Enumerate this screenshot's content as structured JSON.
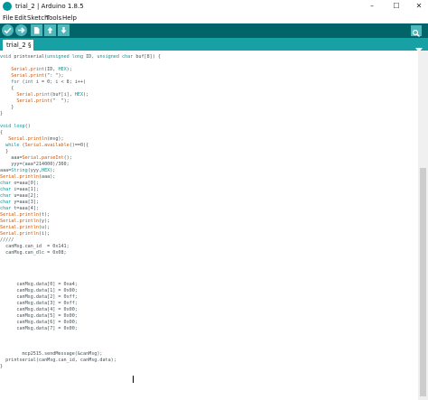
{
  "window": {
    "title": "trial_2 | Arduino 1.8.5",
    "buttons": {
      "minimize": "–",
      "maximize": "☐",
      "close": "✕"
    }
  },
  "menu": [
    "File",
    "Edit",
    "Sketch",
    "Tools",
    "Help"
  ],
  "toolbar": {
    "buttons": [
      "verify-icon",
      "upload-icon",
      "new-icon",
      "open-icon",
      "save-icon"
    ],
    "serial_monitor": "serial-monitor-icon"
  },
  "tabs": [
    {
      "label": "trial_2 §"
    }
  ],
  "editor": {
    "colors": {
      "keyword": "#00979c",
      "function": "#d35400",
      "string": "#005c5f",
      "text": "#434f54"
    },
    "lines": [
      [
        [
          "kw",
          "void"
        ],
        [
          "t",
          " printserial("
        ],
        [
          "kw",
          "unsigned long"
        ],
        [
          "t",
          " ID, "
        ],
        [
          "kw",
          "unsigned char"
        ],
        [
          "t",
          " buf[8]) {"
        ]
      ],
      [],
      [
        [
          "t",
          "    "
        ],
        [
          "fn",
          "Serial"
        ],
        [
          "t",
          "."
        ],
        [
          "fn",
          "print"
        ],
        [
          "t",
          "(ID, "
        ],
        [
          "kw",
          "HEX"
        ],
        [
          "t",
          ");"
        ]
      ],
      [
        [
          "t",
          "    "
        ],
        [
          "fn",
          "Serial"
        ],
        [
          "t",
          "."
        ],
        [
          "fn",
          "print"
        ],
        [
          "t",
          "(\": \");"
        ]
      ],
      [
        [
          "t",
          "    "
        ],
        [
          "kw",
          "for"
        ],
        [
          "t",
          " ("
        ],
        [
          "kw",
          "int"
        ],
        [
          "t",
          " i = 0; i < 8; i++)"
        ]
      ],
      [
        [
          "t",
          "    {"
        ]
      ],
      [
        [
          "t",
          "      "
        ],
        [
          "fn",
          "Serial"
        ],
        [
          "t",
          "."
        ],
        [
          "fn",
          "print"
        ],
        [
          "t",
          "(buf[i], "
        ],
        [
          "kw",
          "HEX"
        ],
        [
          "t",
          ");"
        ]
      ],
      [
        [
          "t",
          "      "
        ],
        [
          "fn",
          "Serial"
        ],
        [
          "t",
          "."
        ],
        [
          "fn",
          "print"
        ],
        [
          "t",
          "(\"  \");"
        ]
      ],
      [
        [
          "t",
          "    }"
        ]
      ],
      [
        [
          "t",
          "}"
        ]
      ],
      [],
      [
        [
          "kw",
          "void"
        ],
        [
          "t",
          " "
        ],
        [
          "kw",
          "loop"
        ],
        [
          "t",
          "()"
        ]
      ],
      [
        [
          "t",
          "{"
        ]
      ],
      [
        [
          "t",
          "   "
        ],
        [
          "fn",
          "Serial"
        ],
        [
          "t",
          "."
        ],
        [
          "fn",
          "println"
        ],
        [
          "t",
          "(msg);"
        ]
      ],
      [
        [
          "t",
          "  "
        ],
        [
          "kw",
          "while"
        ],
        [
          "t",
          " ("
        ],
        [
          "fn",
          "Serial"
        ],
        [
          "t",
          "."
        ],
        [
          "fn",
          "available"
        ],
        [
          "t",
          "()==0){"
        ]
      ],
      [
        [
          "t",
          "  }"
        ]
      ],
      [
        [
          "t",
          "    aaa="
        ],
        [
          "fn",
          "Serial"
        ],
        [
          "t",
          "."
        ],
        [
          "fn",
          "parseInt"
        ],
        [
          "t",
          "();"
        ]
      ],
      [
        [
          "t",
          "    yyy=(aaa*214000)/360;"
        ]
      ],
      [
        [
          "t",
          "aaa="
        ],
        [
          "kw",
          "String"
        ],
        [
          "t",
          "(yyy,"
        ],
        [
          "kw",
          "HEX"
        ],
        [
          "t",
          ");"
        ]
      ],
      [
        [
          "fn",
          "Serial"
        ],
        [
          "t",
          "."
        ],
        [
          "fn",
          "println"
        ],
        [
          "t",
          "(aaa);"
        ]
      ],
      [
        [
          "kw",
          "char"
        ],
        [
          "t",
          " o=aaa[0];"
        ]
      ],
      [
        [
          "kw",
          "char"
        ],
        [
          "t",
          " i=aaa[1];"
        ]
      ],
      [
        [
          "kw",
          "char"
        ],
        [
          "t",
          " u=aaa[2];"
        ]
      ],
      [
        [
          "kw",
          "char"
        ],
        [
          "t",
          " y=aaa[3];"
        ]
      ],
      [
        [
          "kw",
          "char"
        ],
        [
          "t",
          " t=aaa[4];"
        ]
      ],
      [
        [
          "fn",
          "Serial"
        ],
        [
          "t",
          "."
        ],
        [
          "fn",
          "println"
        ],
        [
          "t",
          "(t);"
        ]
      ],
      [
        [
          "fn",
          "Serial"
        ],
        [
          "t",
          "."
        ],
        [
          "fn",
          "println"
        ],
        [
          "t",
          "(y);"
        ]
      ],
      [
        [
          "fn",
          "Serial"
        ],
        [
          "t",
          "."
        ],
        [
          "fn",
          "println"
        ],
        [
          "t",
          "(u);"
        ]
      ],
      [
        [
          "fn",
          "Serial"
        ],
        [
          "t",
          "."
        ],
        [
          "fn",
          "println"
        ],
        [
          "t",
          "(i);"
        ]
      ],
      [
        [
          "t",
          "/////"
        ]
      ],
      [
        [
          "t",
          "  canMsg.can_id  = 0x141;"
        ]
      ],
      [
        [
          "t",
          "  canMsg.can_dlc = 0x08;"
        ]
      ],
      [],
      [],
      [],
      [],
      [
        [
          "t",
          "      canMsg.data[0] = 0xa4;"
        ]
      ],
      [
        [
          "t",
          "      canMsg.data[1] = 0x00;"
        ]
      ],
      [
        [
          "t",
          "      canMsg.data[2] = 0xff;"
        ]
      ],
      [
        [
          "t",
          "      canMsg.data[3] = 0xff;"
        ]
      ],
      [
        [
          "t",
          "      canMsg.data[4] = 0x00;"
        ]
      ],
      [
        [
          "t",
          "      canMsg.data[5] = 0x00;"
        ]
      ],
      [
        [
          "t",
          "      canMsg.data[6] = 0x00;"
        ]
      ],
      [
        [
          "t",
          "      canMsg.data[7] = 0x00;"
        ]
      ],
      [],
      [],
      [],
      [
        [
          "t",
          "        mcp2515.sendMessage(&canMsg);"
        ]
      ],
      [
        [
          "t",
          "  printserial(canMsg.can_id, canMsg.data);"
        ]
      ],
      [
        [
          "t",
          "}"
        ]
      ]
    ]
  }
}
